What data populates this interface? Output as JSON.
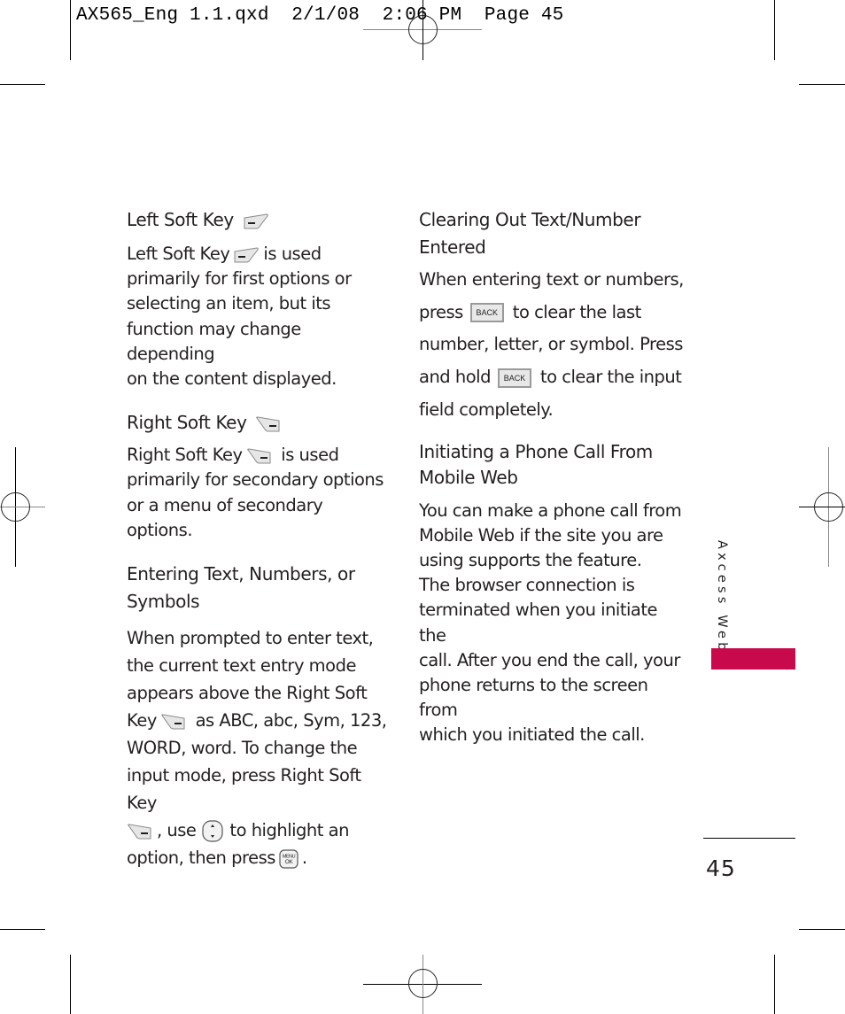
{
  "slug_line": "AX565_Eng 1.1.qxd  2/1/08  2:06 PM  Page 45",
  "left_column": {
    "sections": [
      {
        "heading": "Left Soft Key",
        "heading_icon": "left-soft-key-icon",
        "body_before_icon": "Left Soft Key",
        "body_icon": "left-soft-key-icon",
        "body_after_icon_line1": "is used",
        "body_rest": [
          "primarily for first options or",
          "selecting an item, but its",
          "function may change depending",
          "on the content displayed."
        ]
      },
      {
        "heading": "Right Soft Key",
        "heading_icon": "right-soft-key-icon",
        "body_before_icon": "Right Soft Key",
        "body_icon": "right-soft-key-icon",
        "body_after_icon_line1": "is used",
        "body_rest": [
          "primarily for secondary options",
          "or a menu of secondary options."
        ]
      },
      {
        "heading_lines": [
          "Entering Text, Numbers, or",
          "Symbols"
        ],
        "lines": [
          "When prompted to enter text,",
          "the current text entry mode",
          "appears above the Right Soft"
        ],
        "line4_before_icon": "Key",
        "line4_after_icon": "as ABC, abc, Sym, 123,",
        "line5": "WORD, word. To change the",
        "line6": "input mode, press Right Soft Key",
        "line7_after_rsk": ", use",
        "line7_after_nav": "to highlight an",
        "line8_before_icon": "option, then press",
        "line8_after_icon": ".",
        "icons": [
          "right-soft-key-icon",
          "navigation-key-icon",
          "menu-ok-key-icon"
        ]
      }
    ]
  },
  "right_column": {
    "sections": [
      {
        "heading_lines": [
          "Clearing Out Text/Number",
          "Entered"
        ],
        "line1": "When entering text or numbers,",
        "line2_before": "press",
        "line2_after": "to clear the last",
        "line3": "number, letter, or symbol. Press",
        "line4_before": "and hold",
        "line4_after": "to clear the input",
        "line5": "field completely.",
        "back_key_label": "BACK"
      },
      {
        "heading_lines": [
          "Initiating a Phone Call From",
          "Mobile Web"
        ],
        "lines": [
          "You can make a phone call from",
          "Mobile Web if the site you are",
          "using supports the feature.",
          "The browser connection is",
          "terminated when you initiate the",
          "call. After you end the call, your",
          "phone returns to the screen from",
          "which you initiated the call."
        ]
      }
    ]
  },
  "side_tab": {
    "label": "Axcess Web",
    "color": "#c8094b"
  },
  "page_number": "45"
}
